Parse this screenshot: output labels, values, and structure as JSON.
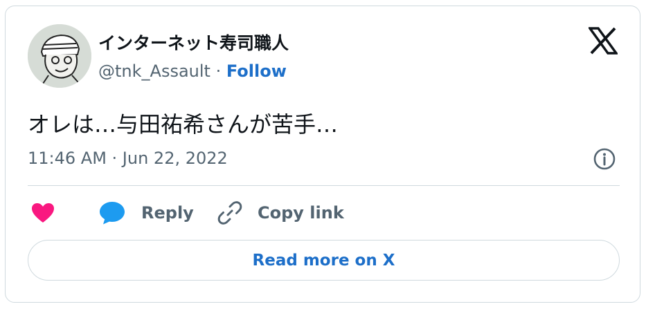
{
  "author": {
    "display_name": "インターネット寿司職人",
    "handle": "@tnk_Assault",
    "separator": " · ",
    "follow_label": "Follow"
  },
  "tweet": {
    "text": "オレは…与田祐希さんが苦手…",
    "timestamp": "11:46 AM · Jun 22, 2022"
  },
  "actions": {
    "like_icon": "heart-icon",
    "reply_icon": "speech-bubble-icon",
    "reply_label": "Reply",
    "copy_icon": "link-icon",
    "copy_label": "Copy link"
  },
  "footer": {
    "read_more_label": "Read more on X"
  },
  "icons": {
    "brand": "x-logo-icon",
    "info": "info-icon"
  },
  "colors": {
    "link_blue": "#1d6fc9",
    "heart_pink": "#f91880",
    "reply_blue": "#1d9bf0",
    "muted_text": "#536471",
    "border": "#cfd9de"
  }
}
